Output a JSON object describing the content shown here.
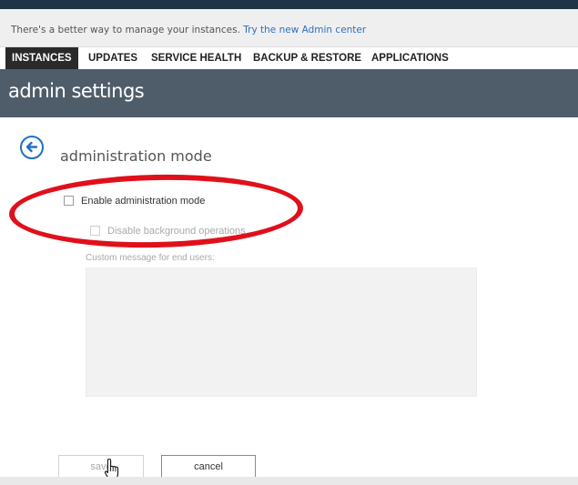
{
  "notice": {
    "text": "There's a better way to manage your instances.",
    "link": "Try the new Admin center"
  },
  "tabs": [
    {
      "label": "INSTANCES",
      "active": true
    },
    {
      "label": "UPDATES",
      "active": false
    },
    {
      "label": "SERVICE HEALTH",
      "active": false
    },
    {
      "label": "BACKUP & RESTORE",
      "active": false
    },
    {
      "label": "APPLICATIONS",
      "active": false
    }
  ],
  "header": {
    "title": "admin settings"
  },
  "section": {
    "title": "administration mode",
    "back_icon": "back-arrow-icon"
  },
  "form": {
    "enable_admin_mode_label": "Enable administration mode",
    "enable_admin_mode_checked": false,
    "disable_background_label": "Disable background operations",
    "disable_background_checked": false,
    "custom_message_label": "Custom message for end users:",
    "custom_message_value": ""
  },
  "buttons": {
    "save": "save",
    "cancel": "cancel"
  },
  "colors": {
    "accent": "#1f6fc5",
    "header_bg": "#4f5d6a",
    "annotation": "#e0101a",
    "link": "#2f6fc0"
  }
}
